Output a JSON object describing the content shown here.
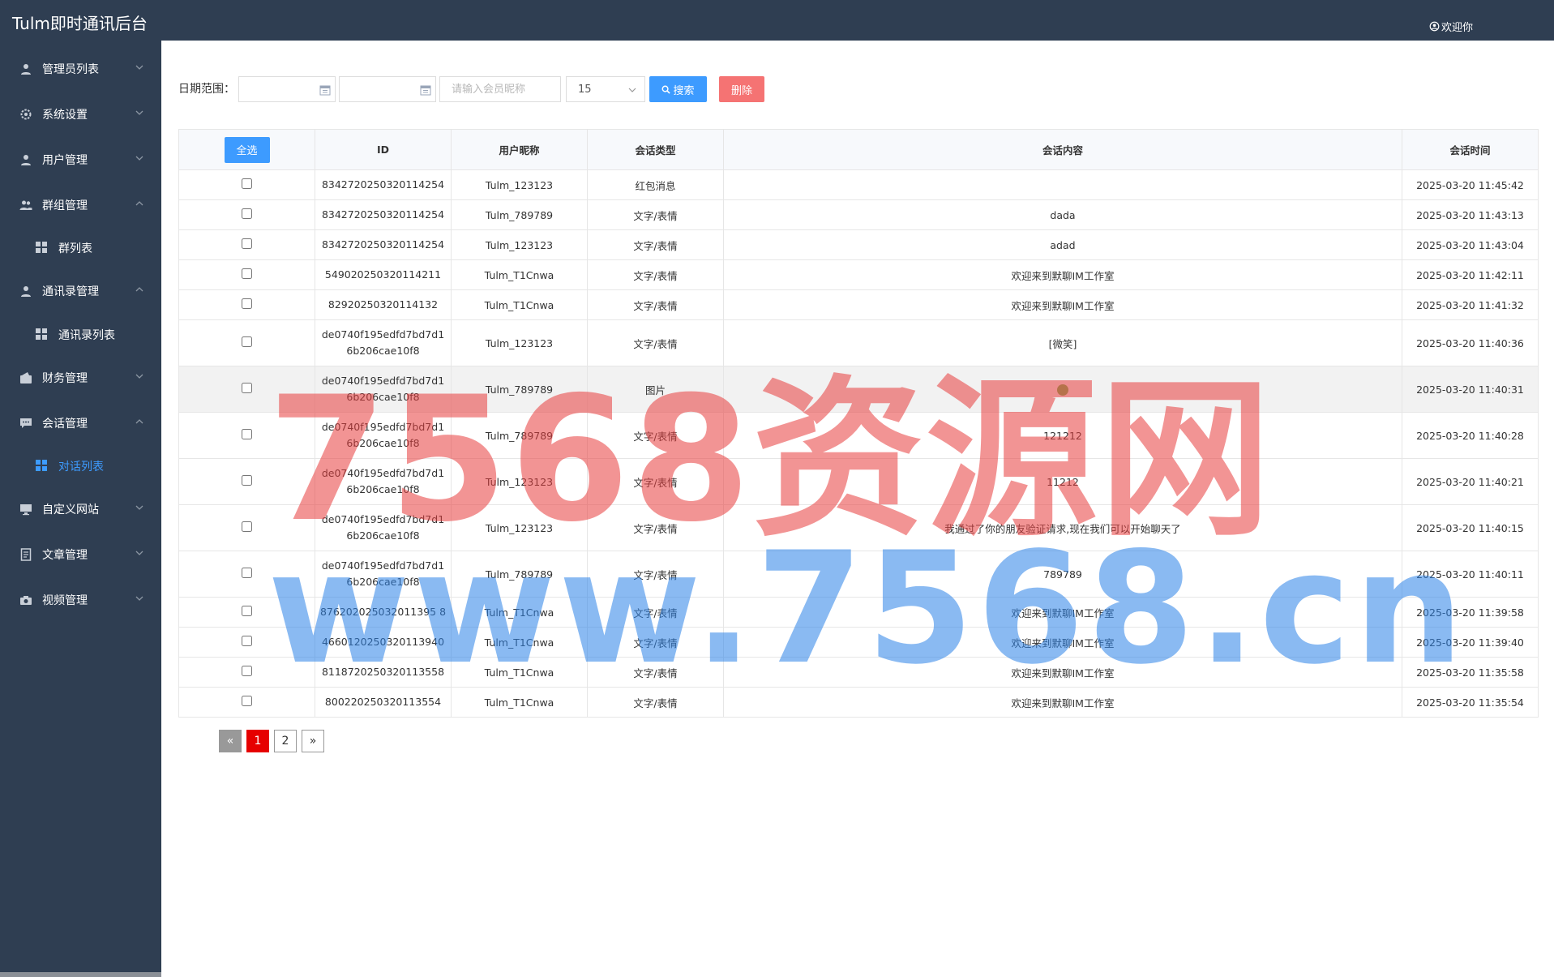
{
  "header": {
    "brand": "Tulm即时通讯后台",
    "welcome": "欢迎你"
  },
  "sidebar": {
    "items": [
      {
        "label": "管理员列表",
        "icon": "user-icon",
        "expanded": false
      },
      {
        "label": "系统设置",
        "icon": "gear-icon",
        "expanded": false
      },
      {
        "label": "用户管理",
        "icon": "user-icon",
        "expanded": false
      },
      {
        "label": "群组管理",
        "icon": "users-icon",
        "expanded": true
      },
      {
        "label": "群列表",
        "icon": "grid-icon",
        "sub": true
      },
      {
        "label": "通讯录管理",
        "icon": "user-icon",
        "expanded": true
      },
      {
        "label": "通讯录列表",
        "icon": "grid-icon",
        "sub": true
      },
      {
        "label": "财务管理",
        "icon": "wallet-icon",
        "expanded": false
      },
      {
        "label": "会话管理",
        "icon": "chat-icon",
        "expanded": true
      },
      {
        "label": "对话列表",
        "icon": "grid-icon",
        "sub": true,
        "active": true
      },
      {
        "label": "自定义网站",
        "icon": "monitor-icon",
        "expanded": false
      },
      {
        "label": "文章管理",
        "icon": "document-icon",
        "expanded": false
      },
      {
        "label": "视频管理",
        "icon": "camera-icon",
        "expanded": false
      }
    ]
  },
  "filter": {
    "date_label": "日期范围：",
    "member_placeholder": "请输入会员昵称",
    "page_size": "15",
    "search_label": "搜索",
    "delete_label": "删除"
  },
  "table": {
    "select_all_label": "全选",
    "headers": [
      "ID",
      "用户昵称",
      "会话类型",
      "会话内容",
      "会话时间"
    ],
    "rows": [
      {
        "id": "8342720250320114254",
        "nick": "Tulm_123123",
        "type": "红包消息",
        "content": "",
        "time": "2025-03-20 11:45:42"
      },
      {
        "id": "8342720250320114254",
        "nick": "Tulm_789789",
        "type": "文字/表情",
        "content": "dada",
        "time": "2025-03-20 11:43:13"
      },
      {
        "id": "8342720250320114254",
        "nick": "Tulm_123123",
        "type": "文字/表情",
        "content": "adad",
        "time": "2025-03-20 11:43:04"
      },
      {
        "id": "549020250320114211",
        "nick": "Tulm_T1Cnwa",
        "type": "文字/表情",
        "content": "欢迎来到默聊IM工作室",
        "time": "2025-03-20 11:42:11"
      },
      {
        "id": "82920250320114132",
        "nick": "Tulm_T1Cnwa",
        "type": "文字/表情",
        "content": "欢迎来到默聊IM工作室",
        "time": "2025-03-20 11:41:32"
      },
      {
        "id": "de0740f195edfd7bd7d16b206cae10f8",
        "nick": "Tulm_123123",
        "type": "文字/表情",
        "content": "[微笑]",
        "time": "2025-03-20 11:40:36"
      },
      {
        "id": "de0740f195edfd7bd7d16b206cae10f8",
        "nick": "Tulm_789789",
        "type": "图片",
        "content": "",
        "time": "2025-03-20 11:40:31"
      },
      {
        "id": "de0740f195edfd7bd7d16b206cae10f8",
        "nick": "Tulm_789789",
        "type": "文字/表情",
        "content": "121212",
        "time": "2025-03-20 11:40:28"
      },
      {
        "id": "de0740f195edfd7bd7d16b206cae10f8",
        "nick": "Tulm_123123",
        "type": "文字/表情",
        "content": "11212",
        "time": "2025-03-20 11:40:21"
      },
      {
        "id": "de0740f195edfd7bd7d16b206cae10f8",
        "nick": "Tulm_123123",
        "type": "文字/表情",
        "content": "我通过了你的朋友验证请求,现在我们可以开始聊天了",
        "time": "2025-03-20 11:40:15"
      },
      {
        "id": "de0740f195edfd7bd7d16b206cae10f8",
        "nick": "Tulm_789789",
        "type": "文字/表情",
        "content": "789789",
        "time": "2025-03-20 11:40:11"
      },
      {
        "id": "876202025032011395 8",
        "nick": "Tulm_T1Cnwa",
        "type": "文字/表情",
        "content": "欢迎来到默聊IM工作室",
        "time": "2025-03-20 11:39:58"
      },
      {
        "id": "4660120250320113940",
        "nick": "Tulm_T1Cnwa",
        "type": "文字/表情",
        "content": "欢迎来到默聊IM工作室",
        "time": "2025-03-20 11:39:40"
      },
      {
        "id": "8118720250320113558",
        "nick": "Tulm_T1Cnwa",
        "type": "文字/表情",
        "content": "欢迎来到默聊IM工作室",
        "time": "2025-03-20 11:35:58"
      },
      {
        "id": "800220250320113554",
        "nick": "Tulm_T1Cnwa",
        "type": "文字/表情",
        "content": "欢迎来到默聊IM工作室",
        "time": "2025-03-20 11:35:54"
      }
    ]
  },
  "pagination": {
    "prev": "«",
    "pages": [
      "1",
      "2"
    ],
    "current": "1",
    "next": "»"
  },
  "watermark": {
    "line1": "7568资源网",
    "line2": "www.7568.cn"
  },
  "colors": {
    "sidebar": "#2f3e52",
    "accent": "#3d9bff",
    "danger": "#f57373",
    "page_active": "#e60000"
  }
}
